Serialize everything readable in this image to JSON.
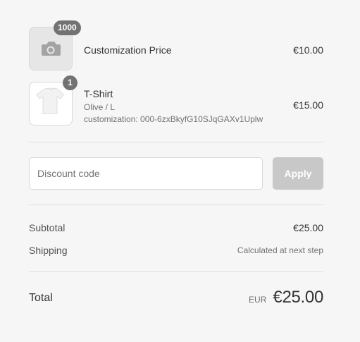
{
  "line_items": [
    {
      "name": "Customization Price",
      "price": "€10.00",
      "quantity": "1000",
      "thumbnail_icon": "camera-icon"
    },
    {
      "name": "T-Shirt",
      "variant": "Olive / L",
      "customization": "customization: 000-6zxBkyfG10SJqGAXv1Uplw",
      "price": "€15.00",
      "quantity": "1",
      "thumbnail_icon": "tshirt-icon"
    }
  ],
  "discount": {
    "placeholder": "Discount code",
    "apply_label": "Apply"
  },
  "subtotal": {
    "label": "Subtotal",
    "value": "€25.00"
  },
  "shipping": {
    "label": "Shipping",
    "value": "Calculated at next step"
  },
  "total": {
    "label": "Total",
    "currency": "EUR",
    "value": "€25.00"
  }
}
